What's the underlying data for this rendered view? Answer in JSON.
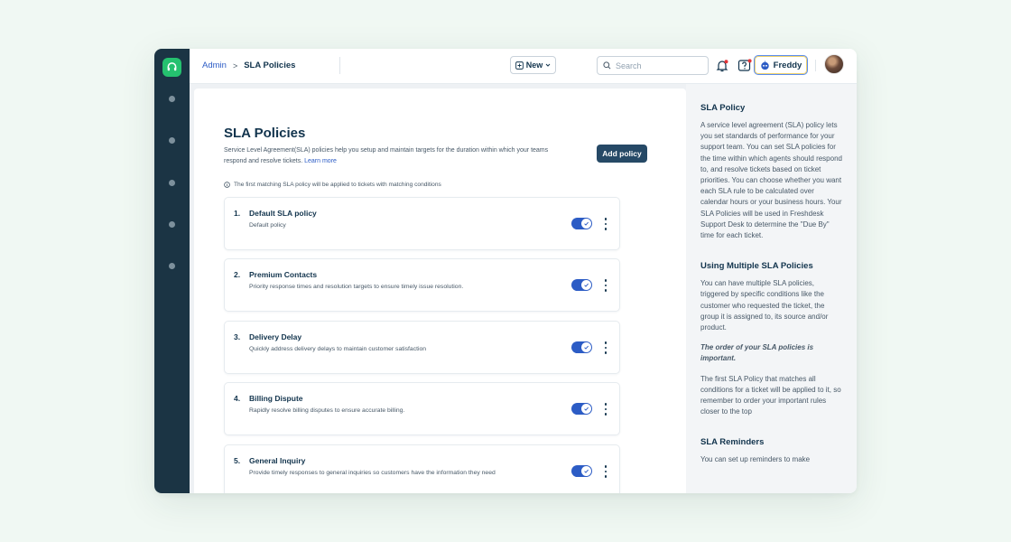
{
  "header": {
    "breadcrumb_root": "Admin",
    "breadcrumb_sep": ">",
    "breadcrumb_current": "SLA Policies",
    "new_label": "New",
    "search_placeholder": "Search",
    "freddy_label": "Freddy"
  },
  "sidebar": {
    "logo_icon": "headset-icon",
    "items": [
      "nav-item-1",
      "nav-item-2",
      "nav-item-3",
      "nav-item-4",
      "nav-item-5"
    ]
  },
  "main": {
    "title": "SLA Policies",
    "description": "Service Level Agreement(SLA) policies help you setup and maintain targets for the duration within which your teams respond and resolve tickets.",
    "learn_more": "Learn more",
    "add_policy_label": "Add policy",
    "note": "The first matching SLA policy will be applied to tickets with matching conditions",
    "policies": [
      {
        "num": "1.",
        "name": "Default SLA policy",
        "desc": "Default policy",
        "enabled": true
      },
      {
        "num": "2.",
        "name": "Premium Contacts",
        "desc": "Priority response times and resolution targets to ensure timely issue resolution.",
        "enabled": true
      },
      {
        "num": "3.",
        "name": "Delivery Delay",
        "desc": "Quickly address delivery delays to maintain customer satisfaction",
        "enabled": true
      },
      {
        "num": "4.",
        "name": "Billing Dispute",
        "desc": "Rapidly resolve billing disputes to  ensure accurate billing.",
        "enabled": true
      },
      {
        "num": "5.",
        "name": "General Inquiry",
        "desc": "Provide timely responses to general inquiries so customers have the information they need",
        "enabled": true
      }
    ]
  },
  "help": {
    "h1": "SLA Policy",
    "p1": "A service level agreement (SLA) policy lets you set standards of performance for your support team. You can set SLA policies for the time within which agents should respond to, and resolve tickets based on ticket priorities. You can choose whether you want each SLA rule to be calculated over calendar hours or your business hours. Your SLA Policies will be used in Freshdesk Support Desk to determine the \"Due By\" time for each ticket.",
    "h2": "Using Multiple SLA Policies",
    "p2": "You can have multiple SLA policies, triggered by specific conditions like the customer who requested the ticket, the group it is assigned to, its source and/or product.",
    "p3": "The order of your SLA policies is important.",
    "p4": "The first SLA Policy that matches all conditions for a ticket will be applied to it, so remember to order your important rules closer to the top",
    "h3": "SLA Reminders",
    "p5": "You can set up reminders to make"
  },
  "colors": {
    "sidebar": "#1b3444",
    "brand_green": "#25c16f",
    "accent_blue": "#2c5cc5",
    "primary_button": "#264966"
  }
}
